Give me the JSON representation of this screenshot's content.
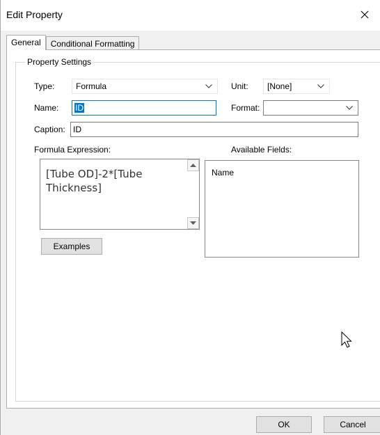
{
  "window": {
    "title": "Edit Property",
    "close_glyph": "×"
  },
  "tabs": [
    {
      "label": "General",
      "active": true
    },
    {
      "label": "Conditional Formatting",
      "active": false
    }
  ],
  "group": {
    "label": "Property Settings"
  },
  "type": {
    "label": "Type:",
    "value": "Formula"
  },
  "unit": {
    "label": "Unit:",
    "value": "[None]"
  },
  "name": {
    "label": "Name:",
    "value": "ID"
  },
  "format": {
    "label": "Format:",
    "value": ""
  },
  "caption": {
    "label": "Caption:",
    "value": "ID"
  },
  "formula": {
    "label": "Formula Expression:",
    "value": "[Tube OD]-2*[Tube Thickness]"
  },
  "available_fields": {
    "label": "Available Fields:",
    "items": [
      "Name"
    ]
  },
  "buttons": {
    "examples": "Examples",
    "ok": "OK",
    "cancel": "Cancel"
  },
  "colors": {
    "focus_border": "#0078d7",
    "selection": "#0078d7",
    "dialog_bg": "#f0f0f0"
  },
  "icons": {
    "close": "close-icon",
    "dropdown": "chevron-down-icon",
    "scroll_up": "scroll-up-arrow-icon",
    "scroll_down": "scroll-down-arrow-icon",
    "cursor": "mouse-pointer-icon"
  }
}
